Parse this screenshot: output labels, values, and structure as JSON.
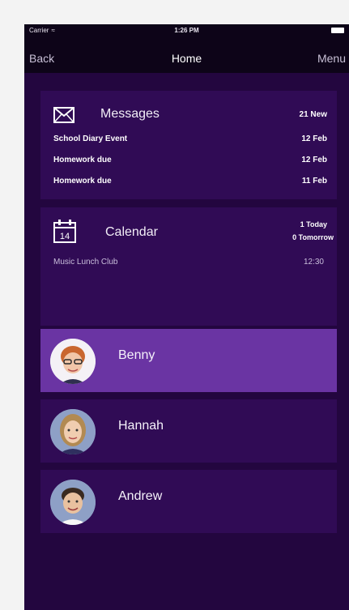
{
  "status_bar": {
    "carrier": "Carrier",
    "time": "1:26 PM"
  },
  "nav": {
    "back": "Back",
    "title": "Home",
    "menu": "Menu"
  },
  "messages": {
    "title": "Messages",
    "new_count": "21 New",
    "items": [
      {
        "subject": "School Diary Event",
        "date": "12 Feb"
      },
      {
        "subject": "Homework due",
        "date": "12 Feb"
      },
      {
        "subject": "Homework due",
        "date": "11 Feb"
      }
    ]
  },
  "calendar": {
    "title": "Calendar",
    "icon_day": "14",
    "today": "1 Today",
    "tomorrow": "0 Tomorrow",
    "event": {
      "name": "Music Lunch Club",
      "time": "12:30"
    }
  },
  "children": [
    {
      "name": "Benny",
      "selected": true
    },
    {
      "name": "Hannah",
      "selected": false
    },
    {
      "name": "Andrew",
      "selected": false
    }
  ],
  "colors": {
    "background": "#23063f",
    "card": "#300b55",
    "selected_row": "#6a34a3",
    "bar": "#0d0418"
  }
}
